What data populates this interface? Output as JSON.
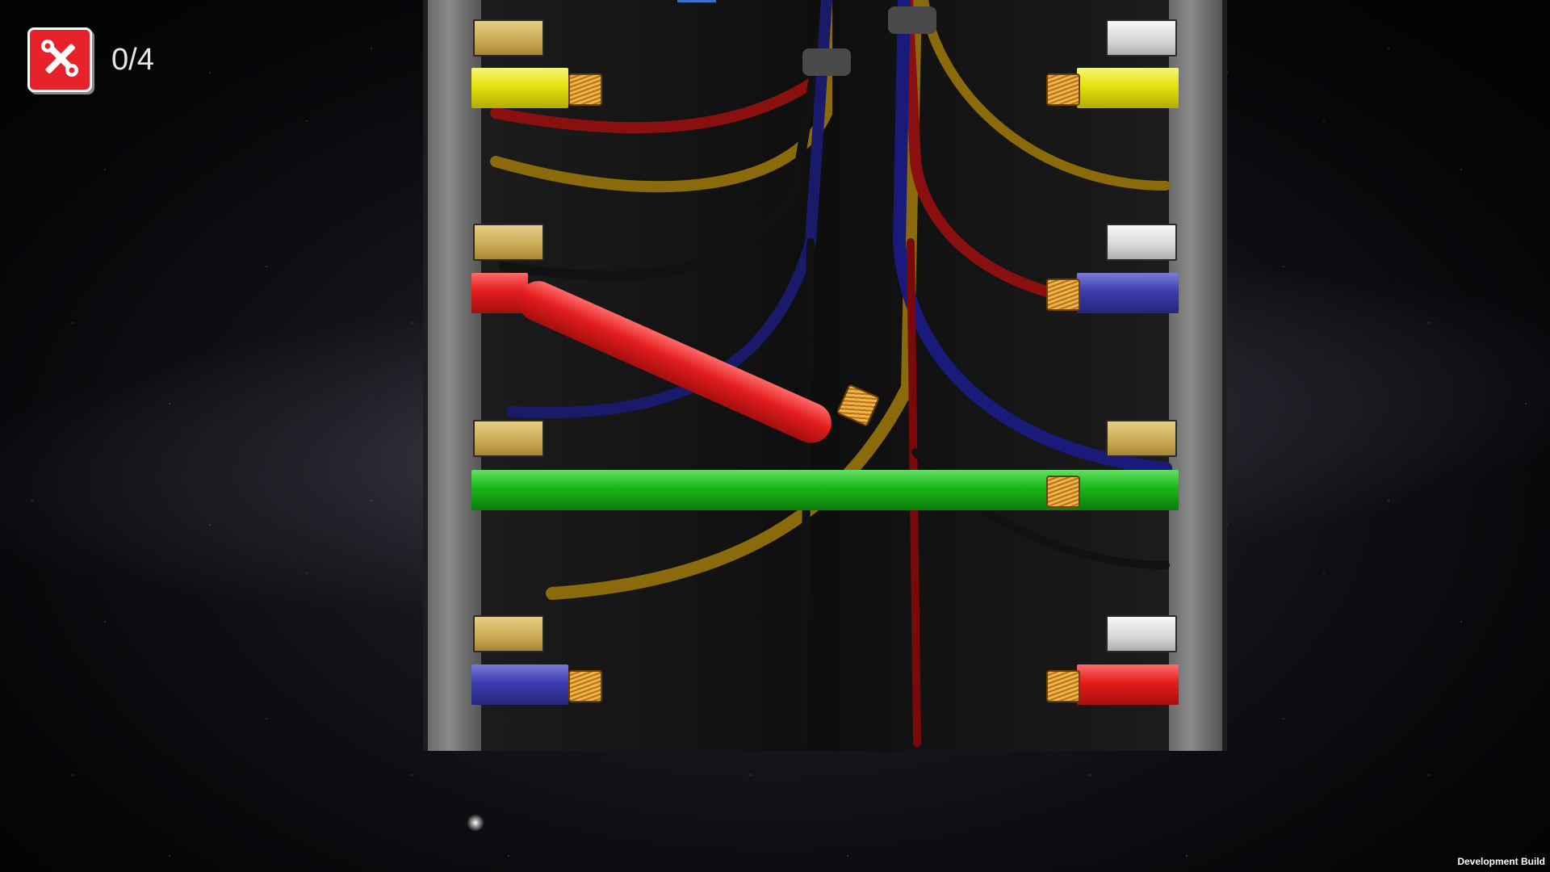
{
  "hud": {
    "tool_icon": "wrench-screwdriver-icon",
    "progress_text": "0/4",
    "progress_value": 0,
    "progress_total": 4
  },
  "left_wires": [
    "yellow",
    "red",
    "gold",
    "blue"
  ],
  "right_wires": [
    "yellow",
    "blue",
    "green",
    "red"
  ],
  "colors": {
    "yellow": "#e6e20c",
    "red": "#e41d1d",
    "blue": "#3d3db0",
    "green": "#19b619",
    "gold_slot": "#caa853",
    "silver_slot": "#d6d6d6",
    "tool_button": "#e8222a"
  },
  "footer": {
    "build_label": "Development Build"
  }
}
